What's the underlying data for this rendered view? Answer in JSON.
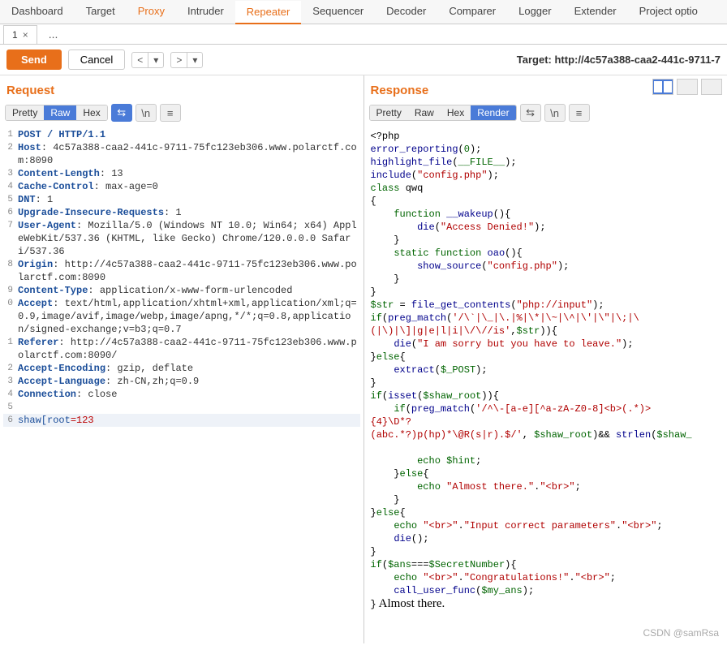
{
  "top_tabs": {
    "dashboard": "Dashboard",
    "target": "Target",
    "proxy": "Proxy",
    "intruder": "Intruder",
    "repeater": "Repeater",
    "sequencer": "Sequencer",
    "decoder": "Decoder",
    "comparer": "Comparer",
    "logger": "Logger",
    "extender": "Extender",
    "project": "Project optio"
  },
  "sub_tabs": {
    "tab1": "1",
    "close": "×",
    "dots": "..."
  },
  "toolbar": {
    "send": "Send",
    "cancel": "Cancel",
    "back": "<",
    "down": "▾",
    "forward": ">",
    "down2": "▾",
    "target_label": "Target: http://4c57a388-caa2-441c-9711-7"
  },
  "request": {
    "title": "Request",
    "views": {
      "pretty": "Pretty",
      "raw": "Raw",
      "hex": "Hex"
    },
    "icons": {
      "wrap": "⇆",
      "newline": "\\n",
      "menu": "≡"
    },
    "lines": [
      {
        "n": "1",
        "h": "",
        "v": "POST / HTTP/1.1"
      },
      {
        "n": "2",
        "h": "Host",
        "v": ": 4c57a388-caa2-441c-9711-75fc123eb306.www.polarctf.com:8090"
      },
      {
        "n": "3",
        "h": "Content-Length",
        "v": ": 13"
      },
      {
        "n": "4",
        "h": "Cache-Control",
        "v": ": max-age=0"
      },
      {
        "n": "5",
        "h": "DNT",
        "v": ": 1"
      },
      {
        "n": "6",
        "h": "Upgrade-Insecure-Requests",
        "v": ": 1"
      },
      {
        "n": "7",
        "h": "User-Agent",
        "v": ": Mozilla/5.0 (Windows NT 10.0; Win64; x64) AppleWebKit/537.36 (KHTML, like Gecko) Chrome/120.0.0.0 Safari/537.36"
      },
      {
        "n": "8",
        "h": "Origin",
        "v": ": http://4c57a388-caa2-441c-9711-75fc123eb306.www.polarctf.com:8090"
      },
      {
        "n": "9",
        "h": "Content-Type",
        "v": ": application/x-www-form-urlencoded"
      },
      {
        "n": "0",
        "h": "Accept",
        "v": ": text/html,application/xhtml+xml,application/xml;q=0.9,image/avif,image/webp,image/apng,*/*;q=0.8,application/signed-exchange;v=b3;q=0.7"
      },
      {
        "n": "1",
        "h": "Referer",
        "v": ": http://4c57a388-caa2-441c-9711-75fc123eb306.www.polarctf.com:8090/"
      },
      {
        "n": "2",
        "h": "Accept-Encoding",
        "v": ": gzip, deflate"
      },
      {
        "n": "3",
        "h": "Accept-Language",
        "v": ": zh-CN,zh;q=0.9"
      },
      {
        "n": "4",
        "h": "Connection",
        "v": ": close"
      },
      {
        "n": "5",
        "h": "",
        "v": ""
      }
    ],
    "body": {
      "n": "6",
      "name": "shaw[root",
      "eq": "=",
      "val": "123"
    }
  },
  "response": {
    "title": "Response",
    "views": {
      "pretty": "Pretty",
      "raw": "Raw",
      "hex": "Hex",
      "render": "Render"
    },
    "icons": {
      "wrap": "⇆",
      "newline": "\\n",
      "menu": "≡"
    },
    "plain_output": " Almost there."
  },
  "watermark": "CSDN @samRsa"
}
